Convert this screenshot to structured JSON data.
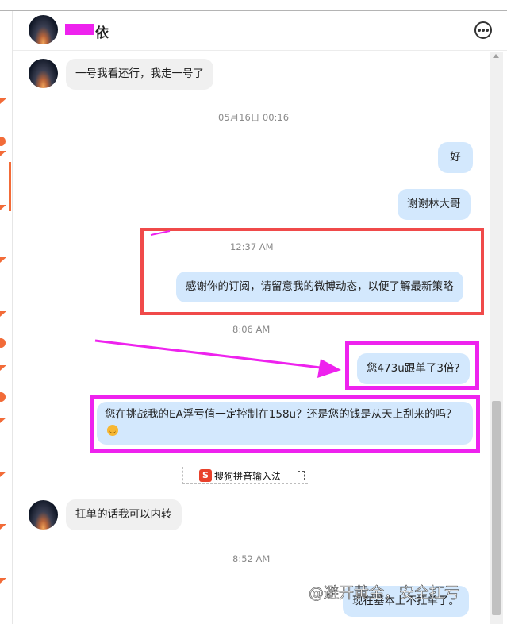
{
  "header": {
    "contact_name": "依",
    "more_icon": "more-horizontal-icon"
  },
  "messages": [
    {
      "type": "incoming",
      "text": "一号我看还行，我走一号了"
    },
    {
      "type": "timestamp",
      "text": "05月16日 00:16"
    },
    {
      "type": "outgoing",
      "text": "好"
    },
    {
      "type": "outgoing",
      "text": "谢谢林大哥"
    },
    {
      "type": "timestamp",
      "text": "12:37 AM"
    },
    {
      "type": "outgoing",
      "text": "感谢你的订阅，请留意我的微博动态，以便了解最新策略"
    },
    {
      "type": "timestamp",
      "text": "8:06 AM"
    },
    {
      "type": "outgoing",
      "text": "您473u跟单了3倍?"
    },
    {
      "type": "outgoing",
      "text": "您在挑战我的EA浮亏值一定控制在158u？还是您的钱是从天上刮来的吗？"
    },
    {
      "type": "incoming",
      "text": "扛单的话我可以内转"
    },
    {
      "type": "timestamp",
      "text": "8:52 AM"
    },
    {
      "type": "outgoing",
      "text": "现在基本上不扛单了。"
    }
  ],
  "ime": {
    "logo": "S",
    "label": "搜狗拼音输入法"
  },
  "watermark": "@避开黄金，安全扛亏",
  "colors": {
    "outgoing_bubble": "#d3e8fd",
    "incoming_bubble": "#f0f0f0",
    "highlight_red": "#f04a4a",
    "highlight_magenta": "#ee22ee",
    "accent_orange": "#f26b38"
  }
}
